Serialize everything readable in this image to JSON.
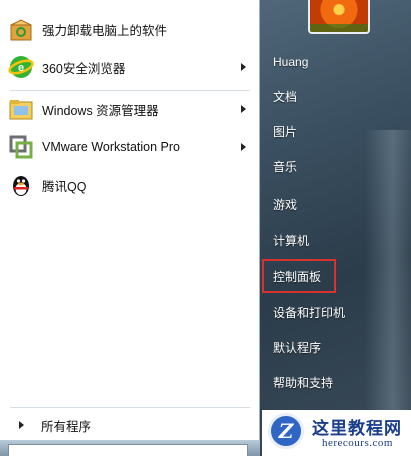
{
  "left_menu": {
    "items": [
      {
        "label": "强力卸载电脑上的软件",
        "icon": "uninstaller-box-icon",
        "has_submenu": false
      },
      {
        "label": "360安全浏览器",
        "icon": "360-browser-icon",
        "has_submenu": true
      },
      {
        "label": "Windows 资源管理器",
        "icon": "folder-explorer-icon",
        "has_submenu": true
      },
      {
        "label": "VMware Workstation Pro",
        "icon": "vmware-icon",
        "has_submenu": true
      },
      {
        "label": "腾讯QQ",
        "icon": "qq-penguin-icon",
        "has_submenu": false
      }
    ],
    "all_programs": "所有程序"
  },
  "right_menu": {
    "user": "Huang",
    "items": [
      "文档",
      "图片",
      "音乐",
      "游戏",
      "计算机",
      "控制面板",
      "设备和打印机",
      "默认程序",
      "帮助和支持"
    ],
    "highlighted": "控制面板"
  },
  "watermark": {
    "title": "这里教程网",
    "url": "herecours.com",
    "logo_letter": "Z"
  },
  "colors": {
    "right_pane": "#3a4f60",
    "highlight_border": "#d8322e",
    "watermark_text": "#1a3d8c"
  }
}
